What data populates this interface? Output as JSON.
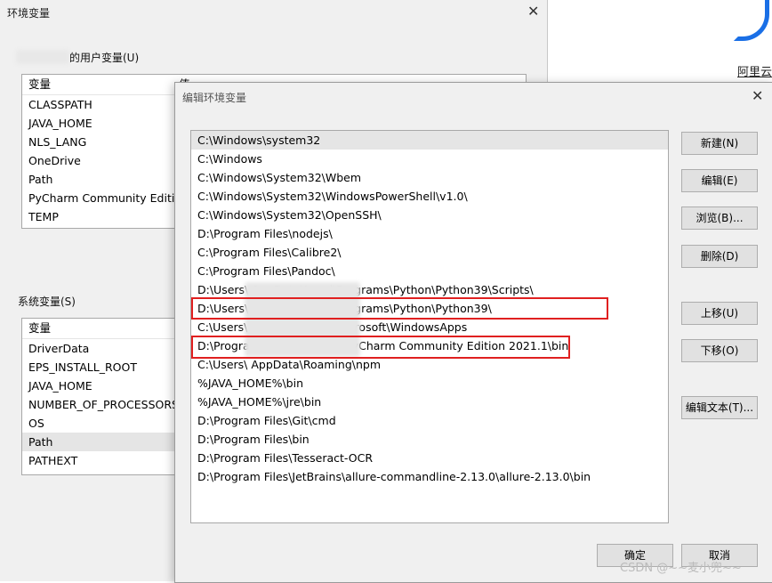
{
  "env_dialog": {
    "title": "环境变量",
    "close_glyph": "✕",
    "user_vars_label": "的用户变量(U)",
    "user_header": {
      "variable": "变量",
      "value": "值"
    },
    "user_rows": [
      "CLASSPATH",
      "JAVA_HOME",
      "NLS_LANG",
      "OneDrive",
      "Path",
      "PyCharm Community Editi...",
      "TEMP"
    ],
    "system_vars_label": "系统变量(S)",
    "system_header": {
      "variable": "变量"
    },
    "system_rows": [
      "DriverData",
      "EPS_INSTALL_ROOT",
      "JAVA_HOME",
      "NUMBER_OF_PROCESSORS",
      "OS",
      "Path",
      "PATHEXT"
    ],
    "system_selected_index": 5
  },
  "right_app": {
    "name": "阿里云",
    "accent_color": "#1a6fe6"
  },
  "edit_dialog": {
    "title": "编辑环境变量",
    "close_glyph": "✕",
    "paths": [
      "C:\\Windows\\system32",
      "C:\\Windows",
      "C:\\Windows\\System32\\Wbem",
      "C:\\Windows\\System32\\WindowsPowerShell\\v1.0\\",
      "C:\\Windows\\System32\\OpenSSH\\",
      "D:\\Program Files\\nodejs\\",
      "C:\\Program Files\\Calibre2\\",
      "C:\\Program Files\\Pandoc\\",
      "D:\\Users\\                              AppData\\Local\\Programs\\Python\\Python39\\Scripts\\",
      "D:\\Users\\                              AppData\\Local\\Programs\\Python\\Python39\\",
      "C:\\Users\\                              AppData\\Local\\Microsoft\\WindowsApps",
      "D:\\Program Files\\JetBrains\\PyCharm Community Edition 2021.1\\bin",
      "C:\\Users\\                              AppData\\Roaming\\npm",
      "%JAVA_HOME%\\bin",
      "%JAVA_HOME%\\jre\\bin",
      "D:\\Program Files\\Git\\cmd",
      "D:\\Program Files\\bin",
      "D:\\Program Files\\Tesseract-OCR",
      "D:\\Program Files\\JetBrains\\allure-commandline-2.13.0\\allure-2.13.0\\bin"
    ],
    "selected_index": 0,
    "highlighted_indices": [
      9,
      11
    ],
    "highlight_color": "#e02020",
    "buttons": {
      "new": "新建(N)",
      "edit": "编辑(E)",
      "browse": "浏览(B)...",
      "delete": "删除(D)",
      "move_up": "上移(U)",
      "move_down": "下移(O)",
      "edit_text": "编辑文本(T)...",
      "ok": "确定",
      "cancel": "取消"
    }
  },
  "watermark": "CSDN @~~麦小兜~~"
}
